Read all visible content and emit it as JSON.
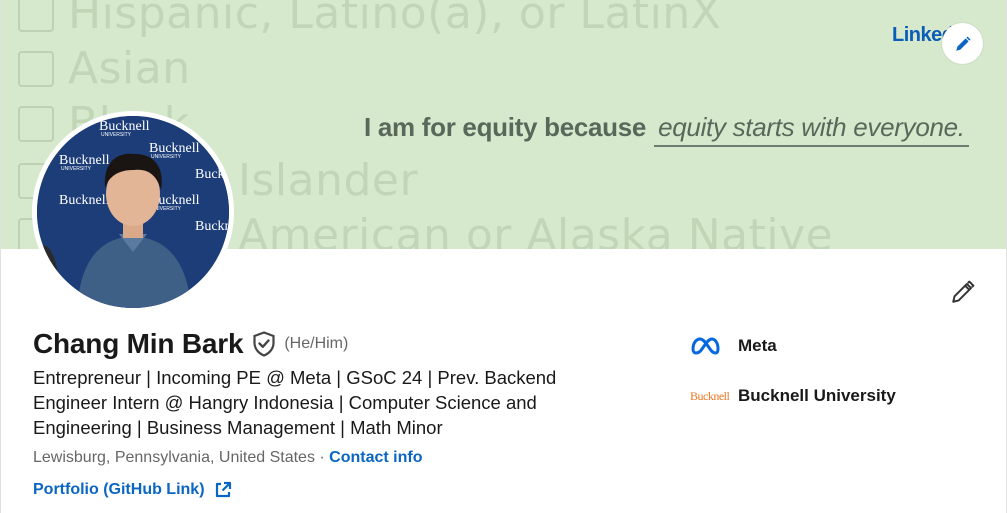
{
  "banner": {
    "form_rows": [
      "Hispanic, Latino(a), or LatinX",
      "Asian",
      "Black",
      "Islander",
      "American or Alaska Native"
    ],
    "equity_prefix": "I am for equity because",
    "equity_suffix": "equity starts with everyone.",
    "brand": "Linked",
    "bg_color": "#d7e9cd"
  },
  "avatar": {
    "backdrop_brand": "Bucknell",
    "backdrop_sub": "UNIVERSITY"
  },
  "profile": {
    "name": "Chang Min Bark",
    "pronouns": "(He/Him)",
    "headline": "Entrepreneur | Incoming PE @ Meta | GSoC 24 | Prev. Backend Engineer Intern @ Hangry Indonesia | Computer Science and Engineering | Business Management | Math Minor",
    "location": "Lewisburg, Pennsylvania, United States",
    "separator": " · ",
    "contact_label": "Contact info",
    "portfolio_label": "Portfolio (GitHub Link)"
  },
  "orgs": [
    {
      "name": "Meta",
      "logo": "meta-logo"
    },
    {
      "name": "Bucknell University",
      "logo": "bucknell-logo",
      "logo_text": "Bucknell"
    }
  ],
  "colors": {
    "link": "#0a66c2",
    "bucknell_orange": "#e87722",
    "meta_blue": "#0668e1"
  }
}
